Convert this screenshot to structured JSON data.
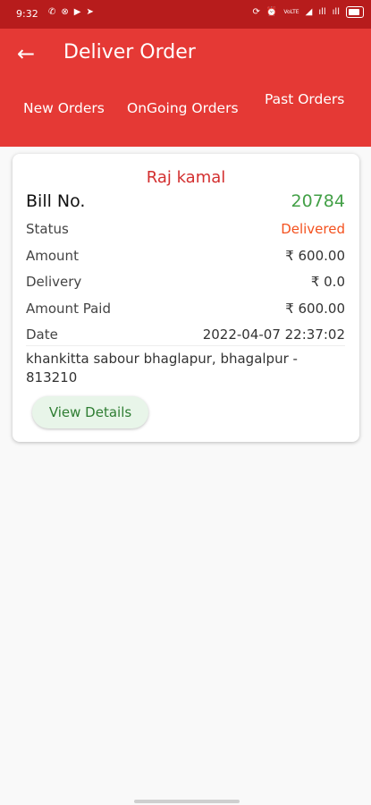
{
  "status_bar": {
    "time": "9:32",
    "left_icons": [
      "✆",
      "⊗",
      "▶",
      "➤"
    ],
    "network_text": "VoLTE",
    "right_icons": [
      "⟳",
      "⏰",
      "◢",
      "ıll",
      "ıll"
    ]
  },
  "app_bar": {
    "title": "Deliver Order",
    "back_icon": "←"
  },
  "tabs": [
    {
      "label": "New Orders"
    },
    {
      "label": "OnGoing Orders"
    },
    {
      "label": "Past Orders",
      "selected": true
    }
  ],
  "order": {
    "customer_name": "Raj kamal",
    "bill_label": "Bill No.",
    "bill_no": "20784",
    "status_label": "Status",
    "status": "Delivered",
    "amount_label": "Amount",
    "amount": "₹ 600.00",
    "delivery_label": "Delivery",
    "delivery": "₹ 0.0",
    "amount_paid_label": "Amount Paid",
    "amount_paid": "₹ 600.00",
    "date_label": "Date",
    "date": "2022-04-07 22:37:02",
    "address": "khankitta sabour bhaglapur, bhagalpur - 813210",
    "view_details_label": "View Details"
  },
  "colors": {
    "app_bar": "#e53935",
    "status_bar": "#b71c1c",
    "customer_name": "#d32f2f",
    "bill_no": "#43a047",
    "status_delivered": "#f4511e",
    "button_bg": "#e8f5e9"
  }
}
